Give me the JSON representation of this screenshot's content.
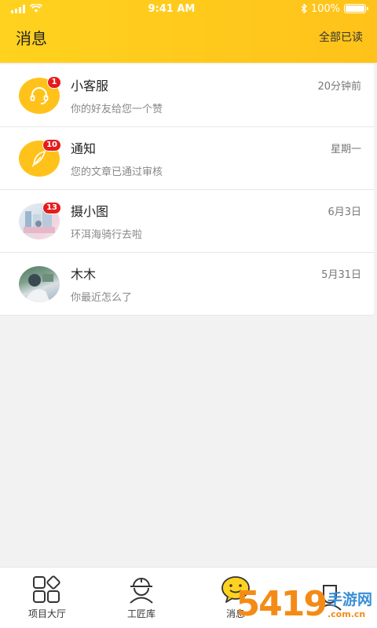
{
  "status_bar": {
    "time": "9:41 AM",
    "battery": "100%",
    "battery_level": 1.0
  },
  "header": {
    "title": "消息",
    "mark_all_read": "全部已读"
  },
  "messages": [
    {
      "name": "小客服",
      "preview": "你的好友给您一个赞",
      "time": "20分钟前",
      "badge": "1",
      "avatar": "headset-icon"
    },
    {
      "name": "通知",
      "preview": "您的文章已通过审核",
      "time": "星期一",
      "badge": "10",
      "avatar": "feather-icon"
    },
    {
      "name": "摄小图",
      "preview": "环洱海骑行去啦",
      "time": "6月3日",
      "badge": "13",
      "avatar": "photo-avatar"
    },
    {
      "name": "木木",
      "preview": "你最近怎么了",
      "time": "5月31日",
      "badge": "",
      "avatar": "photo-avatar"
    }
  ],
  "tabs": [
    {
      "label": "项目大厅",
      "icon": "grid-icon"
    },
    {
      "label": "工匠库",
      "icon": "worker-icon"
    },
    {
      "label": "消息",
      "icon": "smile-chat-icon",
      "active": true
    },
    {
      "label": "",
      "icon": "profile-icon"
    }
  ],
  "watermark": {
    "num": "5419",
    "cn": "手游网",
    "url": ".com.cn"
  },
  "colors": {
    "accent": "#ffc21a",
    "badge": "#e61c1c"
  }
}
